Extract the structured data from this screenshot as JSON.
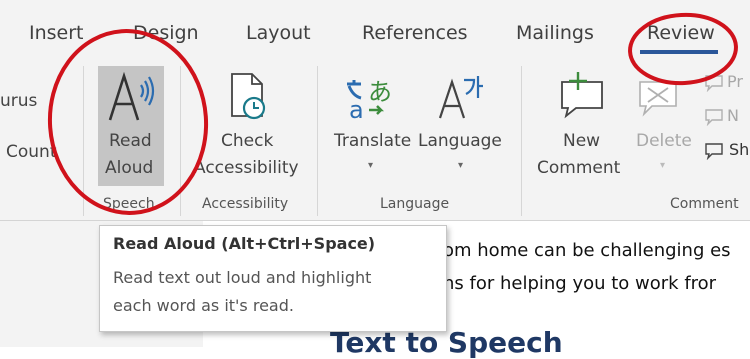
{
  "tabs": [
    {
      "label": "Insert"
    },
    {
      "label": "Design"
    },
    {
      "label": "Layout"
    },
    {
      "label": "References"
    },
    {
      "label": "Mailings"
    },
    {
      "label": "Review"
    }
  ],
  "ribbon": {
    "proofing_partial": {
      "line1": "urus",
      "line2": "Count"
    },
    "read_aloud": {
      "line1": "Read",
      "line2": "Aloud"
    },
    "check_accessibility": {
      "line1": "Check",
      "line2": "Accessibility"
    },
    "translate": {
      "label": "Translate"
    },
    "language": {
      "label": "Language"
    },
    "new_comment": {
      "line1": "New",
      "line2": "Comment"
    },
    "delete": {
      "label": "Delete"
    },
    "side_items": [
      "Pr",
      "N",
      "Sh"
    ],
    "groups": {
      "speech": "Speech",
      "accessibility": "Accessibility",
      "language": "Language",
      "comments": "Comment"
    }
  },
  "tooltip": {
    "title": "Read Aloud (Alt+Ctrl+Space)",
    "line1": "Read text out loud and highlight",
    "line2": "each word as it's read."
  },
  "document": {
    "line1": "om home can be challenging es",
    "line2": "ns for helping you to work fror",
    "heading": "Text to Speech"
  },
  "colors": {
    "annotation_circle": "#d0121b",
    "active_tab_underline": "#2b579a",
    "heading": "#1f3864",
    "icon_green": "#3c8c3c",
    "icon_teal": "#1a7a8a",
    "icon_blue": "#2b6cb0"
  }
}
